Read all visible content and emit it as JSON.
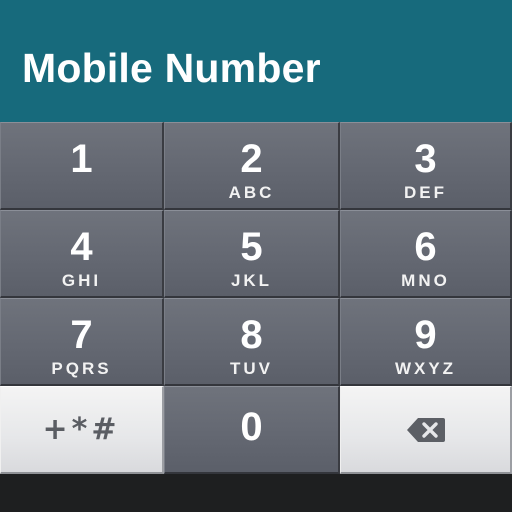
{
  "header": {
    "title": "Mobile Number",
    "background_color": "#176a7c"
  },
  "keypad": {
    "keys": [
      {
        "digit": "1",
        "letters": ""
      },
      {
        "digit": "2",
        "letters": "ABC"
      },
      {
        "digit": "3",
        "letters": "DEF"
      },
      {
        "digit": "4",
        "letters": "GHI"
      },
      {
        "digit": "5",
        "letters": "JKL"
      },
      {
        "digit": "6",
        "letters": "MNO"
      },
      {
        "digit": "7",
        "letters": "PQRS"
      },
      {
        "digit": "8",
        "letters": "TUV"
      },
      {
        "digit": "9",
        "letters": "WXYZ"
      }
    ],
    "symbols_key": "+*#",
    "zero_key": "0",
    "backspace_icon": "backspace-icon",
    "key_color": "#666a73",
    "light_key_color": "#e6e7e9"
  }
}
